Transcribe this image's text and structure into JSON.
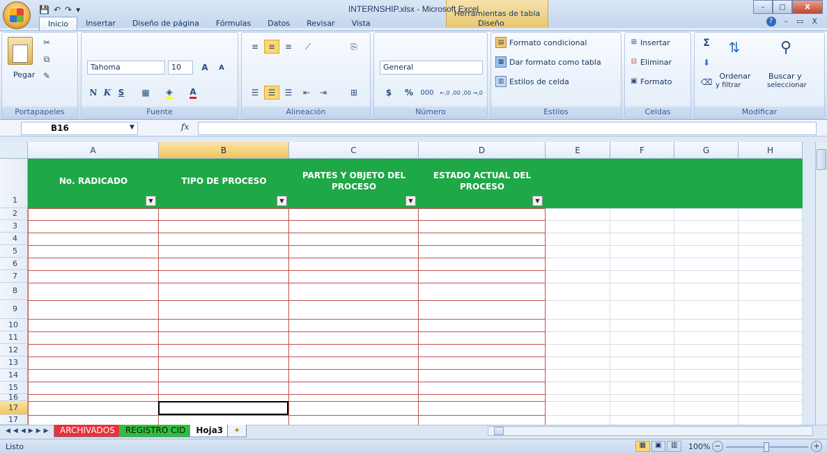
{
  "window": {
    "title": "INTERNSHIP.xlsx - Microsoft Excel",
    "context_tab_group": "Herramientas de tabla",
    "minimize": "–",
    "maximize": "□",
    "close": "X"
  },
  "qat": {
    "save": "💾",
    "undo": "↶",
    "redo": "↷",
    "more": "▾"
  },
  "tabs": [
    "Inicio",
    "Insertar",
    "Diseño de página",
    "Fórmulas",
    "Datos",
    "Revisar",
    "Vista"
  ],
  "active_tab": "Inicio",
  "context_tab": "Diseño",
  "mdi_controls": {
    "help": "?",
    "min": "–",
    "restore": "▭",
    "close": "X"
  },
  "ribbon": {
    "portapapeles": {
      "title": "Portapapeles",
      "paste": "Pegar"
    },
    "fuente": {
      "title": "Fuente",
      "font": "Tahoma",
      "size": "10",
      "bold": "N",
      "italic": "K",
      "underline": "S",
      "grow": "A",
      "shrink": "A"
    },
    "alineacion": {
      "title": "Alineación"
    },
    "numero": {
      "title": "Número",
      "format": "General",
      "currency": "$",
      "percent": "%",
      "thousands": "000",
      "inc_decimals": "←,0 ,00",
      "dec_decimals": ",00 →,0"
    },
    "estilos": {
      "title": "Estilos",
      "conditional": "Formato condicional",
      "as_table": "Dar formato como tabla",
      "cell_styles": "Estilos de celda"
    },
    "celdas": {
      "title": "Celdas",
      "insert": "Insertar",
      "delete": "Eliminar",
      "format": "Formato"
    },
    "modificar": {
      "title": "Modificar",
      "sum": "Σ",
      "sort": "Ordenar",
      "sort_sub": "y filtrar",
      "find": "Buscar y",
      "find_sub": "seleccionar"
    }
  },
  "formula_bar": {
    "name_box": "B16",
    "fx": "fx",
    "value": ""
  },
  "columns": [
    "A",
    "B",
    "C",
    "D",
    "E",
    "F",
    "G",
    "H"
  ],
  "selected_column": "B",
  "header_row": "1",
  "rows": [
    "2",
    "3",
    "4",
    "5",
    "6",
    "7",
    "8",
    "9",
    "10",
    "11",
    "12",
    "13",
    "14",
    "15",
    "16",
    "17"
  ],
  "selected_row": "16",
  "table_headers": [
    "No. RADICADO",
    "TIPO DE PROCESO",
    "PARTES Y OBJETO DEL PROCESO",
    "ESTADO ACTUAL DEL PROCESO"
  ],
  "sheets": [
    {
      "name": "ARCHIVADOS",
      "color": "#e8313c"
    },
    {
      "name": "REGISTRO CID",
      "color": "#2fbf3a"
    },
    {
      "name": "Hoja3",
      "color": "#ffffff"
    }
  ],
  "active_sheet": "Hoja3",
  "status": {
    "ready": "Listo",
    "zoom": "100%",
    "zoom_out": "−",
    "zoom_in": "+"
  },
  "colors": {
    "table_header": "#1fa847",
    "table_border": "#c0504d",
    "accent": "#15325a"
  }
}
